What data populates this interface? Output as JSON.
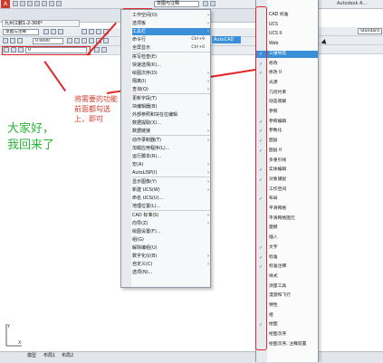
{
  "app": {
    "logo": "A",
    "title_dropdown": "草图与注释",
    "app_title": "Autodesk A..."
  },
  "doc_tab": "九州江鹏1-2-306*",
  "workspace_combo": "草图与注释",
  "left_toolbar": {
    "combo_value": "0.0000",
    "layer_value": "0"
  },
  "right_toolbar": {
    "style_value": "Standard"
  },
  "tools_menu": {
    "items": [
      {
        "label": "工作空间(O)",
        "arrow": "›",
        "shortcut": ""
      },
      {
        "label": "选项板",
        "arrow": "›",
        "shortcut": ""
      },
      {
        "label": "工具栏",
        "arrow": "›",
        "shortcut": "",
        "highlight": true
      },
      {
        "label": "命令行",
        "arrow": "",
        "shortcut": "Ctrl+9"
      },
      {
        "label": "全屏显示",
        "arrow": "",
        "shortcut": "Ctrl+0"
      },
      {
        "label": "拼写检查(E)",
        "arrow": "",
        "shortcut": ""
      },
      {
        "label": "快速选择(K)...",
        "arrow": "",
        "shortcut": ""
      },
      {
        "label": "绘图次序(D)",
        "arrow": "›",
        "shortcut": ""
      },
      {
        "label": "隔离(I)",
        "arrow": "›",
        "shortcut": ""
      },
      {
        "label": "查询(Q)",
        "arrow": "›",
        "shortcut": ""
      },
      {
        "label": "更新字段(T)",
        "arrow": "",
        "shortcut": ""
      },
      {
        "label": "块编辑器(B)",
        "arrow": "",
        "shortcut": ""
      },
      {
        "label": "外部参照和块在位编辑",
        "arrow": "›",
        "shortcut": ""
      },
      {
        "label": "数据提取(X)...",
        "arrow": "",
        "shortcut": ""
      },
      {
        "label": "数据链接",
        "arrow": "›",
        "shortcut": ""
      },
      {
        "label": "动作录制器(T)",
        "arrow": "›",
        "shortcut": ""
      },
      {
        "label": "加载应用程序(L)...",
        "arrow": "",
        "shortcut": ""
      },
      {
        "label": "运行脚本(R)...",
        "arrow": "",
        "shortcut": ""
      },
      {
        "label": "宏(A)",
        "arrow": "›",
        "shortcut": ""
      },
      {
        "label": "AutoLISP(I)",
        "arrow": "›",
        "shortcut": ""
      },
      {
        "label": "显示图像(Y)",
        "arrow": "›",
        "shortcut": ""
      },
      {
        "label": "新建 UCS(W)",
        "arrow": "›",
        "shortcut": ""
      },
      {
        "label": "命名 UCS(U)...",
        "arrow": "",
        "shortcut": ""
      },
      {
        "label": "地理位置(L)...",
        "arrow": "",
        "shortcut": ""
      },
      {
        "label": "CAD 标准(S)",
        "arrow": "›",
        "shortcut": ""
      },
      {
        "label": "向导(Z)",
        "arrow": "›",
        "shortcut": ""
      },
      {
        "label": "绘图设置(F)...",
        "arrow": "",
        "shortcut": ""
      },
      {
        "label": "组(G)",
        "arrow": "",
        "shortcut": ""
      },
      {
        "label": "解除编组(U)",
        "arrow": "",
        "shortcut": ""
      },
      {
        "label": "数字化仪(B)",
        "arrow": "›",
        "shortcut": ""
      },
      {
        "label": "自定义(C)",
        "arrow": "›",
        "shortcut": ""
      },
      {
        "label": "选项(N)...",
        "arrow": "",
        "shortcut": ""
      }
    ],
    "submenu_hint": "AutoCAD"
  },
  "toolbars_list": {
    "items": [
      {
        "label": "CAD 标准",
        "checked": false
      },
      {
        "label": "UCS",
        "checked": false
      },
      {
        "label": "UCS II",
        "checked": false
      },
      {
        "label": "Web",
        "checked": false
      },
      {
        "label": "三维导航",
        "checked": true,
        "highlight": true
      },
      {
        "label": "修改",
        "checked": true
      },
      {
        "label": "修改 II",
        "checked": true
      },
      {
        "label": "光源",
        "checked": false
      },
      {
        "label": "几何约束",
        "checked": false
      },
      {
        "label": "动态观察",
        "checked": false
      },
      {
        "label": "参照",
        "checked": false
      },
      {
        "label": "参照编辑",
        "checked": true
      },
      {
        "label": "参数化",
        "checked": true
      },
      {
        "label": "图层",
        "checked": true
      },
      {
        "label": "图层 II",
        "checked": true
      },
      {
        "label": "多重引线",
        "checked": false
      },
      {
        "label": "实体编辑",
        "checked": true
      },
      {
        "label": "对象捕捉",
        "checked": true
      },
      {
        "label": "工作空间",
        "checked": false
      },
      {
        "label": "布局",
        "checked": true
      },
      {
        "label": "平滑网格",
        "checked": false
      },
      {
        "label": "平滑网格图元",
        "checked": false
      },
      {
        "label": "建模",
        "checked": false
      },
      {
        "label": "插入",
        "checked": false
      },
      {
        "label": "文字",
        "checked": true
      },
      {
        "label": "标准",
        "checked": true
      },
      {
        "label": "标准注释",
        "checked": true
      },
      {
        "label": "样式",
        "checked": false
      },
      {
        "label": "测量工具",
        "checked": false
      },
      {
        "label": "漫游和飞行",
        "checked": false
      },
      {
        "label": "特性",
        "checked": false
      },
      {
        "label": "组",
        "checked": false
      },
      {
        "label": "绘图",
        "checked": true
      },
      {
        "label": "绘图次序",
        "checked": false
      },
      {
        "label": "绘图次序, 注释前置",
        "checked": false
      }
    ]
  },
  "annotations": {
    "red_note": "将需要的功能前面都勾选上，即可",
    "green_note": "大家好，我回来了"
  },
  "status_tabs": [
    "模型",
    "布局1",
    "布局2"
  ],
  "colors": {
    "accent": "#3b8fd6",
    "annotation_red": "#e0262a",
    "annotation_green": "#2ab43a"
  }
}
